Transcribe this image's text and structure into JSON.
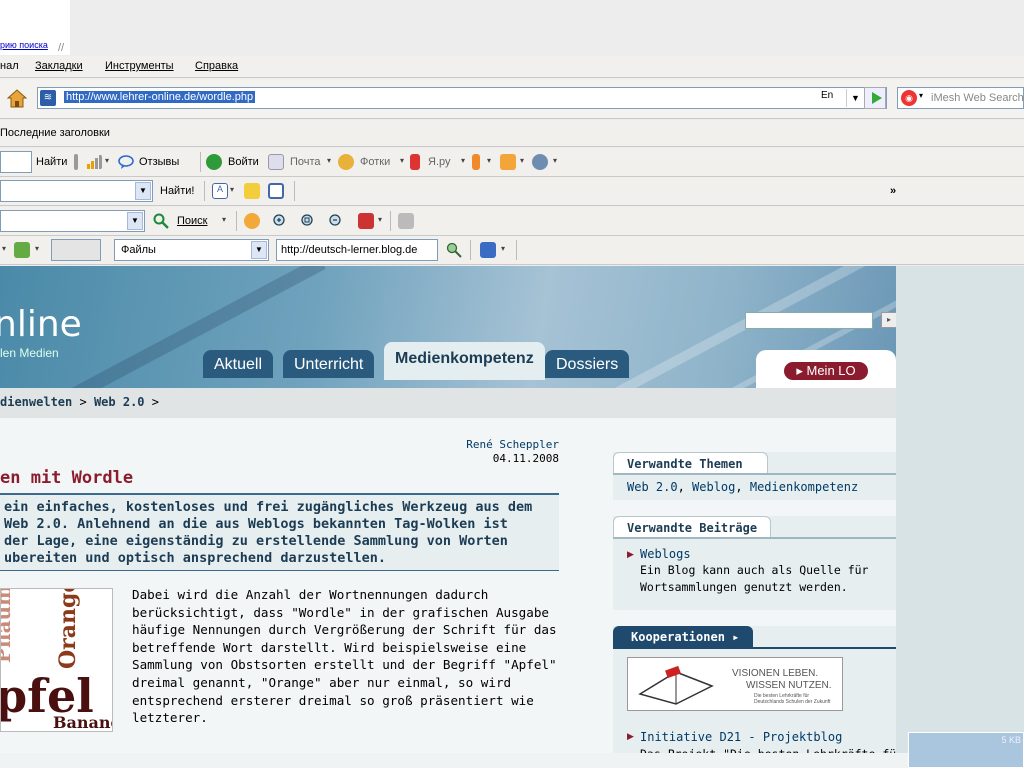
{
  "top": {
    "link_text": "рию поиска"
  },
  "menu": {
    "items": [
      "нал",
      "Закладки",
      "Инструменты",
      "Справка"
    ]
  },
  "nav": {
    "url": "http://www.lehrer-online.de/wordle.php",
    "lang_icon": "En",
    "search_placeholder": "iMesh Web Search",
    "search_engine_icon": "imesh-icon"
  },
  "bookmarks": {
    "label": "Последние заголовки"
  },
  "toolbar1": {
    "find": "Найти",
    "reviews": "Отзывы",
    "login": "Войти",
    "mail": "Почта",
    "photos": "Фотки",
    "yaru": "Я.ру"
  },
  "toolbar2": {
    "find": "Найти!",
    "overflow": "»"
  },
  "toolbar3": {
    "search": "Поиск"
  },
  "toolbar4": {
    "files": "Файлы",
    "url": "http://deutsch-lerner.blog.de"
  },
  "site": {
    "logo": "nline",
    "logo_sub": "len Medien",
    "tabs": [
      "Aktuell",
      "Unterricht",
      "Medienkompetenz",
      "Dossiers"
    ],
    "active_tab": "Medienkompetenz",
    "mein_lo": "▸ Mein LO",
    "accent": "#8b1c2e",
    "navy": "#1c3c54"
  },
  "breadcrumb": {
    "items": [
      "dienwelten",
      "Web 2.0"
    ],
    "separator": ">"
  },
  "article": {
    "author": "René Scheppler",
    "date": "04.11.2008",
    "title": "en mit Wordle",
    "lead": [
      "ein einfaches, kostenloses und frei zugängliches Werkzeug aus dem",
      "Web 2.0. Anlehnend an die aus Weblogs bekannten Tag-Wolken ist",
      "der Lage, eine eigenständig zu erstellende Sammlung von Worten",
      "ubereiten und optisch ansprechend darzustellen."
    ],
    "image_words": [
      "Orange",
      "Pflaume",
      "pfel",
      "Banane"
    ],
    "body": [
      "Dabei wird die Anzahl der Wortnennungen dadurch",
      "berücksichtigt, dass \"Wordle\" in der grafischen Ausgabe",
      "häufige Nennungen durch Vergrößerung der Schrift für das",
      "betreffende Wort darstellt. Wird beispielsweise eine",
      "Sammlung von Obstsorten erstellt und der Begriff \"Apfel\"",
      "dreimal genannt, \"Orange\" aber nur einmal, so wird",
      "entsprechend ersterer dreimal so groß präsentiert wie",
      "letzterer."
    ]
  },
  "sidebar": {
    "related_topics": {
      "title": "Verwandte Themen",
      "links": [
        "Web 2.0",
        "Weblog",
        "Medienkompetenz"
      ]
    },
    "related_posts": {
      "title": "Verwandte Beiträge",
      "link": "Weblogs",
      "text": [
        "Ein Blog kann auch als Quelle für",
        "Wortsammlungen genutzt werden."
      ]
    },
    "cooperations": {
      "title": "Kooperationen ▸",
      "banner_lines": [
        "VISIONEN LEBEN.",
        "WISSEN NUTZEN."
      ],
      "banner_small": [
        "Die besten Lehrkräfte für",
        "Deutschlands Schulen der Zukunft"
      ],
      "link": "Initiative D21 - Projektblog",
      "text": "Das Projekt \"Die besten Lehrkräfte für"
    }
  },
  "status": {
    "kb": "5 KB"
  }
}
